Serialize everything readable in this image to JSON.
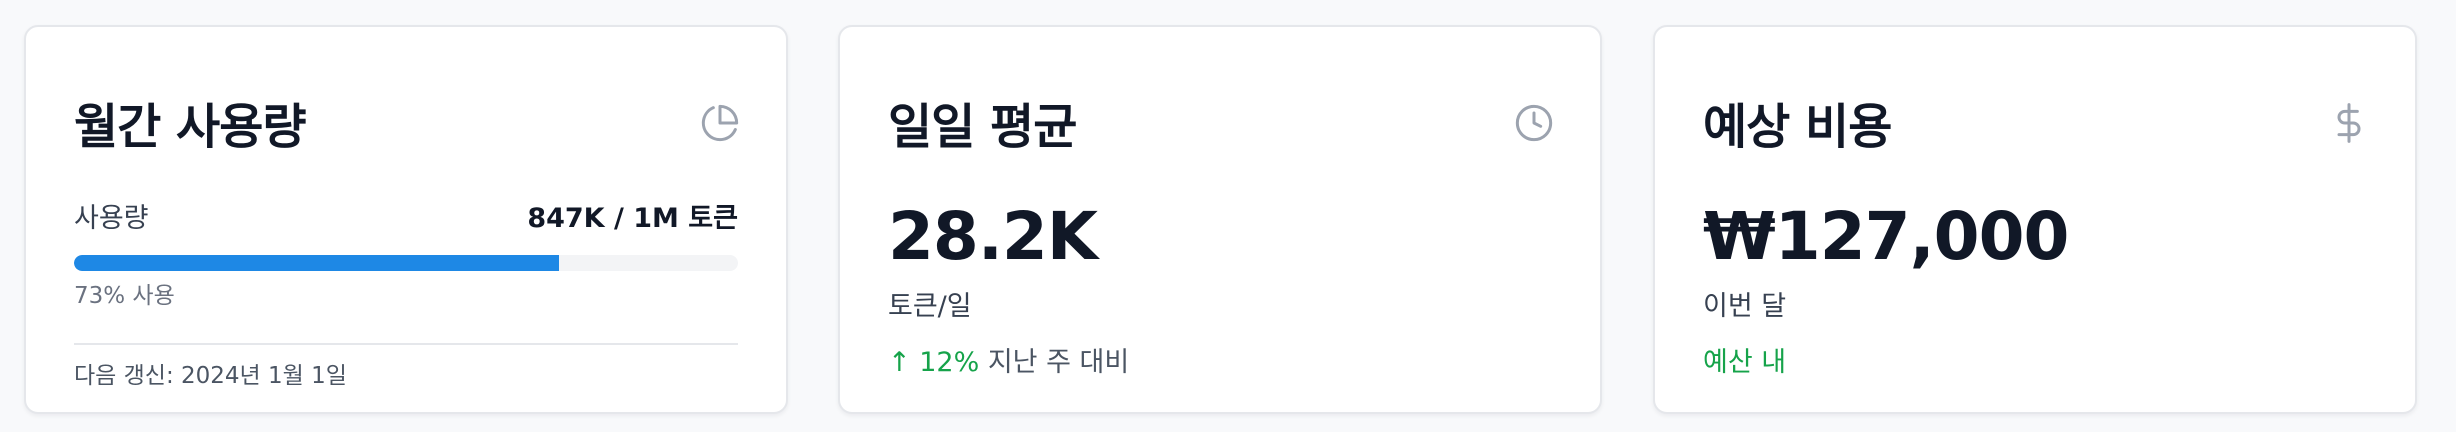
{
  "colors": {
    "accent": "#1e88e5",
    "positive": "#16a34a",
    "icon": "#9ca3af"
  },
  "monthly": {
    "title": "월간 사용량",
    "icon": "pie-chart-icon",
    "usage_label": "사용량",
    "usage_value": "847K / 1M 토큰",
    "progress_fraction": 0.73,
    "progress_caption": "73% 사용",
    "renewal": "다음 갱신: 2024년 1월 1일"
  },
  "daily": {
    "title": "일일 평균",
    "icon": "clock-icon",
    "value": "28.2K",
    "unit": "토큰/일",
    "trend_arrow": "↑",
    "trend_percent": "12%",
    "trend_text": "지난 주 대비"
  },
  "cost": {
    "title": "예상 비용",
    "icon": "dollar-icon",
    "value": "₩127,000",
    "period": "이번 달",
    "status": "예산 내"
  }
}
